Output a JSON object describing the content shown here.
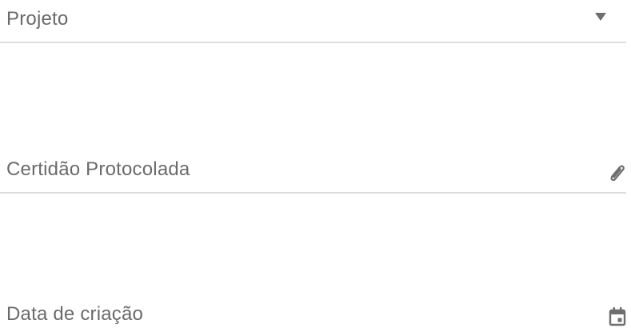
{
  "form": {
    "fields": [
      {
        "label": "Projeto",
        "type": "select",
        "icon": "dropdown-triangle-icon"
      },
      {
        "label": "Certidão Protocolada",
        "type": "file",
        "icon": "paperclip-icon"
      },
      {
        "label": "Data de criação",
        "type": "date",
        "icon": "calendar-icon"
      }
    ]
  },
  "colors": {
    "text": "#6a6a6a",
    "underline": "#dedede",
    "icon": "#777777"
  }
}
